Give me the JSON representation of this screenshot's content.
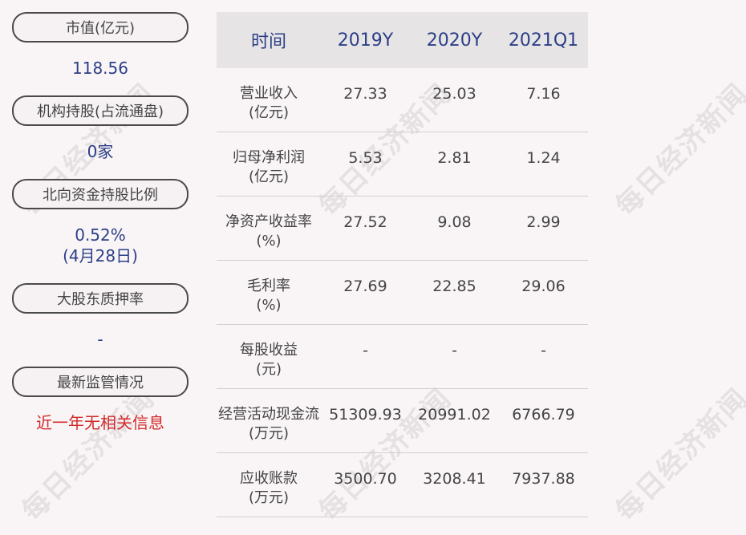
{
  "watermark_text": "每日经济新闻",
  "left": {
    "items": [
      {
        "label": "市值(亿元)",
        "value": "118.56"
      },
      {
        "label": "机构持股(占流通盘)",
        "value": "0家"
      },
      {
        "label": "北向资金持股比例",
        "value": "0.52%",
        "value2": "(4月28日)"
      },
      {
        "label": "大股东质押率",
        "value": "-"
      },
      {
        "label": "最新监管情况",
        "value": "近一年无相关信息"
      }
    ],
    "colors": {
      "value_blue": "#2b3f86",
      "value_red": "#d42a2a"
    }
  },
  "table": {
    "headers": [
      "时间",
      "2019Y",
      "2020Y",
      "2021Q1"
    ],
    "rows": [
      {
        "label": "营业收入",
        "unit": "(亿元)",
        "values": [
          "27.33",
          "25.03",
          "7.16"
        ]
      },
      {
        "label": "归母净利润",
        "unit": "(亿元)",
        "values": [
          "5.53",
          "2.81",
          "1.24"
        ]
      },
      {
        "label": "净资产收益率",
        "unit": "(%)",
        "values": [
          "27.52",
          "9.08",
          "2.99"
        ]
      },
      {
        "label": "毛利率",
        "unit": "(%)",
        "values": [
          "27.69",
          "22.85",
          "29.06"
        ]
      },
      {
        "label": "每股收益",
        "unit": "(元)",
        "values": [
          "-",
          "-",
          "-"
        ]
      },
      {
        "label": "经营活动现金流",
        "unit": "(万元)",
        "values": [
          "51309.93",
          "20991.02",
          "6766.79"
        ]
      },
      {
        "label": "应收账款",
        "unit": "(万元)",
        "values": [
          "3500.70",
          "3208.41",
          "7937.88"
        ]
      }
    ]
  }
}
